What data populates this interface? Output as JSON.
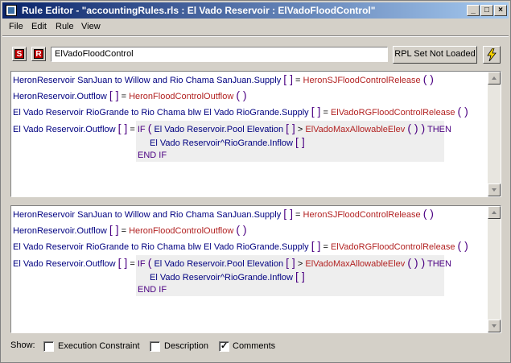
{
  "window": {
    "title": "Rule Editor - \"accountingRules.rls : El Vado Reservoir : ElVadoFloodControl\""
  },
  "menu": [
    "File",
    "Edit",
    "Rule",
    "View"
  ],
  "toolbar": {
    "s_label": "S",
    "r_label": "R",
    "rule_name": "ElVadoFloodControl",
    "rpl_status": "RPL Set Not Loaded"
  },
  "panels": [
    {
      "lines": [
        {
          "lhs": "HeronReservoir SanJuan to Willow and Rio Chama SanJuan.Supply",
          "eq": "=",
          "rhs": "HeronSJFloodControlRelease"
        },
        {
          "lhs": "HeronReservoir.Outflow",
          "eq": "=",
          "rhs": "HeronFloodControlOutflow"
        },
        {
          "lhs": "El Vado Reservoir RioGrande to Rio Chama blw El Vado RioGrande.Supply",
          "eq": "=",
          "rhs": "ElVadoRGFloodControlRelease"
        },
        {
          "lhs": "El Vado Reservoir.Outflow",
          "eq": "=",
          "if_kw": "IF",
          "cond_obj": "El Vado Reservoir.Pool Elevation",
          "op": ">",
          "cond_fn": "ElVadoMaxAllowableElev",
          "then_kw": "THEN",
          "then_expr": "El Vado Reservoir^RioGrande.Inflow",
          "end_kw": "END IF"
        }
      ]
    },
    {
      "lines": [
        {
          "lhs": "HeronReservoir SanJuan to Willow and Rio Chama SanJuan.Supply",
          "eq": "=",
          "rhs": "HeronSJFloodControlRelease"
        },
        {
          "lhs": "HeronReservoir.Outflow",
          "eq": "=",
          "rhs": "HeronFloodControlOutflow"
        },
        {
          "lhs": "El Vado Reservoir RioGrande to Rio Chama blw El Vado RioGrande.Supply",
          "eq": "=",
          "rhs": "ElVadoRGFloodControlRelease"
        },
        {
          "lhs": "El Vado Reservoir.Outflow",
          "eq": "=",
          "if_kw": "IF",
          "cond_obj": "El Vado Reservoir.Pool Elevation",
          "op": ">",
          "cond_fn": "ElVadoMaxAllowableElev",
          "then_kw": "THEN",
          "then_expr": "El Vado Reservoir^RioGrande.Inflow",
          "end_kw": "END IF"
        }
      ]
    }
  ],
  "show": {
    "label": "Show:",
    "options": [
      {
        "label": "Execution Constraint",
        "checked": false
      },
      {
        "label": "Description",
        "checked": false
      },
      {
        "label": "Comments",
        "checked": true
      }
    ]
  },
  "colors": {
    "title_start": "#0a246a",
    "title_end": "#a6caf0",
    "object": "#000080",
    "function": "#b22222",
    "keyword": "#4b0082"
  }
}
